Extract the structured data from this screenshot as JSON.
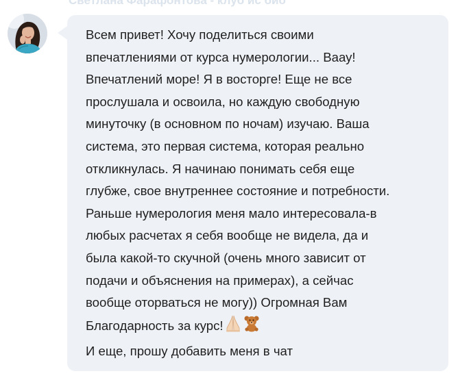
{
  "sender": {
    "name": "Светлана Фарафонтова - клуб ис био"
  },
  "message": {
    "lines": [
      "Всем привет! Хочу поделиться своими",
      "впечатлениями от курса нумерологии... Ваау!",
      "Впечатлений море! Я в восторге! Еще не все",
      "прослушала и освоила, но каждую свободную",
      "минуточку (в основном по ночам) изучаю. Ваша",
      "система, это первая система, которая реально",
      "откликнулась. Я начинаю понимать себя еще",
      "глубже, свое внутреннее состояние и потребности.",
      "Раньше нумерология меня мало интересовала-в",
      "любых расчетах я себя вообще не видела, да и",
      "была какой-то скучной (очень много зависит от",
      "подачи и объяснения на примерах), а сейчас",
      "вообще оторваться не могу)) Огромная Вам",
      "Благодарность за курс!"
    ],
    "emoji_icons": [
      "folded-hands-icon",
      "teddy-bear-icon"
    ],
    "last_line": "И еще, прошу добавить меня в чат"
  },
  "colors": {
    "bubble_background": "#eef1f6",
    "text": "#1f1f1f",
    "sender_name": "#dbe3ec"
  }
}
